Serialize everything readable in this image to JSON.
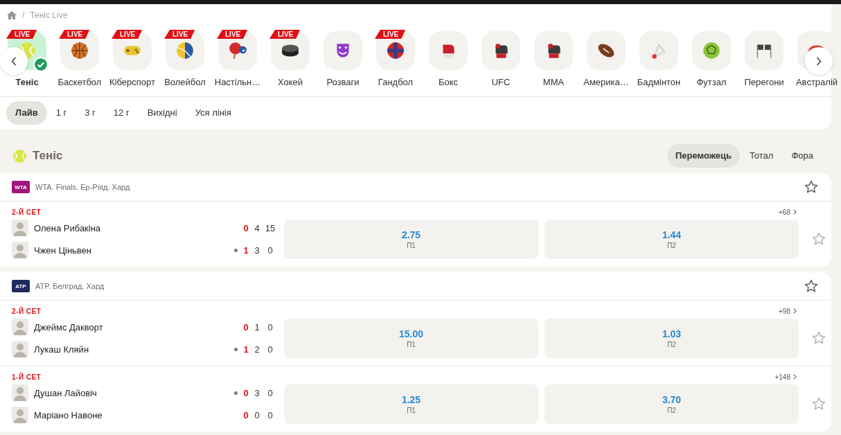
{
  "breadcrumb": {
    "separator": "/",
    "current": "Теніс Live"
  },
  "sports": [
    {
      "label": "Теніс",
      "kind": "tennis",
      "badge": "LIVE",
      "selected": true
    },
    {
      "label": "Баскетбол",
      "kind": "basketball",
      "badge": "LIVE",
      "selected": false
    },
    {
      "label": "Кіберспорт",
      "kind": "gamepad",
      "badge": "LIVE",
      "selected": false
    },
    {
      "label": "Волейбол",
      "kind": "volleyball",
      "badge": "LIVE",
      "selected": false
    },
    {
      "label": "Настільн…",
      "kind": "pingpong",
      "badge": "LIVE",
      "selected": false
    },
    {
      "label": "Хокей",
      "kind": "puck",
      "badge": "LIVE",
      "selected": false
    },
    {
      "label": "Розваги",
      "kind": "mask",
      "selected": false
    },
    {
      "label": "Гандбол",
      "kind": "handball",
      "badge": "LIVE",
      "selected": false
    },
    {
      "label": "Бокс",
      "kind": "boxing",
      "selected": false
    },
    {
      "label": "UFC",
      "kind": "glove",
      "selected": false
    },
    {
      "label": "MMA",
      "kind": "glove",
      "selected": false
    },
    {
      "label": "Америка…",
      "kind": "football",
      "selected": false
    },
    {
      "label": "Бадмінтон",
      "kind": "shuttlecock",
      "selected": false
    },
    {
      "label": "Футзал",
      "kind": "futsal",
      "selected": false
    },
    {
      "label": "Перегони",
      "kind": "flags",
      "selected": false
    },
    {
      "label": "Австралій",
      "kind": "rugby",
      "selected": false
    }
  ],
  "time_filters": [
    {
      "label": "Лайв",
      "selected": true
    },
    {
      "label": "1 г",
      "selected": false
    },
    {
      "label": "3 г",
      "selected": false
    },
    {
      "label": "12 г",
      "selected": false
    },
    {
      "label": "Вихідні",
      "selected": false
    },
    {
      "label": "Уся лінія",
      "selected": false
    }
  ],
  "section": {
    "title": "Теніс"
  },
  "market_tabs": [
    {
      "label": "Переможець",
      "selected": true
    },
    {
      "label": "Тотал",
      "selected": false
    },
    {
      "label": "Фора",
      "selected": false
    }
  ],
  "leagues": [
    {
      "name": "WTA. Finals. Ер-Ріяд. Хард",
      "logo": "WTA",
      "matches": [
        {
          "period": "2-Й СЕТ",
          "more": "+68",
          "players": [
            {
              "name": "Олена Рибакіна",
              "serving": false,
              "sets": "0",
              "games": "4",
              "points": "15"
            },
            {
              "name": "Чжен Ціньвен",
              "serving": true,
              "sets": "1",
              "games": "3",
              "points": "0"
            }
          ],
          "odds": [
            {
              "value": "2.75",
              "label": "П1"
            },
            {
              "value": "1.44",
              "label": "П2"
            }
          ]
        }
      ]
    },
    {
      "name": "ATP. Белград. Хард",
      "logo": "ATP",
      "matches": [
        {
          "period": "2-Й СЕТ",
          "more": "+98",
          "players": [
            {
              "name": "Джеймс Дакворт",
              "serving": false,
              "sets": "0",
              "games": "1",
              "points": "0"
            },
            {
              "name": "Лукаш Кляйн",
              "serving": true,
              "sets": "1",
              "games": "2",
              "points": "0"
            }
          ],
          "odds": [
            {
              "value": "15.00",
              "label": "П1"
            },
            {
              "value": "1.03",
              "label": "П2"
            }
          ]
        },
        {
          "period": "1-Й СЕТ",
          "more": "+148",
          "players": [
            {
              "name": "Душан Лайовіч",
              "serving": true,
              "sets": "0",
              "games": "3",
              "points": "0"
            },
            {
              "name": "Маріано Навоне",
              "serving": false,
              "sets": "0",
              "games": "0",
              "points": "0"
            }
          ],
          "odds": [
            {
              "value": "1.25",
              "label": "П1"
            },
            {
              "value": "3.70",
              "label": "П2"
            }
          ]
        }
      ]
    }
  ]
}
